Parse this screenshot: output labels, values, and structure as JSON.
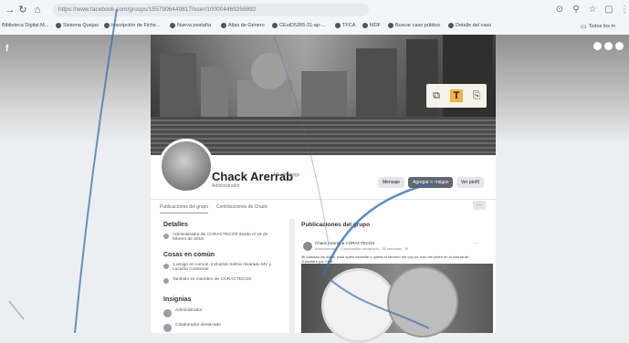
{
  "browser": {
    "url": "https://www.facebook.com/groups/1557906449817/user/100004469258892",
    "bookmarks": [
      "Biblioteca Digital M...",
      "Sistema Quejas",
      "Inscripción de Fiche...",
      "Nueva pestaña",
      "Atlas de Género",
      "CEuiD5265-31-ap-...",
      "TFCA",
      "MDF",
      "Buscar caso público",
      "Detalle del caso"
    ],
    "all_bookmarks": "Todos los m"
  },
  "profile": {
    "name": "Chack Arerrab",
    "add_friend": "Añadir amigo",
    "role": "Administrador",
    "buttons": {
      "message": "Mensaje",
      "add_friend": "Agregar a amigos",
      "view_profile": "Ver perfil"
    },
    "tabs": [
      "Publicaciones del grupo",
      "Contribuciones de Chack"
    ],
    "more": "···"
  },
  "details": {
    "title": "Detalles",
    "item1": "Administrador de CORACTECOS desde el 19 de febrero de 2018",
    "common_title": "Cosas en común",
    "common1": "1 amigo en común, incluidos Selma Alvarado MV y Lucerito Contreras",
    "common2": "También es miembro de CORACTECOS",
    "badges_title": "Insignias",
    "badge1": "Administrador",
    "badge2": "Colaborador destacado"
  },
  "feed": {
    "title": "Publicaciones del grupo",
    "post": {
      "author": "Chack Arerrab ▸ CORACTECOS",
      "meta": "Administrador · Colaborador destacado · 36 semanas · ⊕",
      "text": "Mi mandan los datos, para quien necesite o quiera el servicio me voy yo, solo me piden en la cuenta de Transfiere por Chat",
      "more": "···"
    }
  },
  "toolbox": {
    "icon1": "copy-icon",
    "icon2": "T",
    "icon3": "bookmark-icon"
  }
}
